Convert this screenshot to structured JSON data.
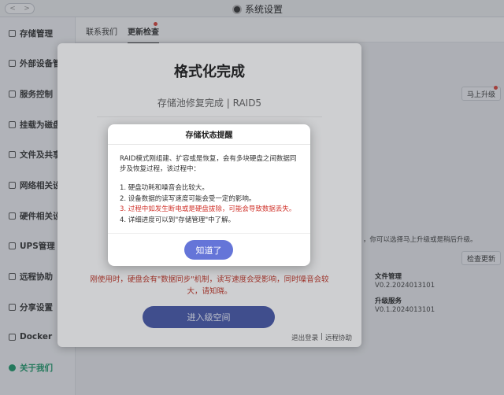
{
  "window": {
    "title": "系统设置",
    "nav_back": "<",
    "nav_forward": ">"
  },
  "sidebar": {
    "items": [
      {
        "label": "存储管理",
        "icon": "storage-icon"
      },
      {
        "label": "外部设备管理",
        "icon": "device-icon"
      },
      {
        "label": "服务控制",
        "icon": "toggle-icon"
      },
      {
        "label": "挂载为磁盘",
        "icon": "disk-icon"
      },
      {
        "label": "文件及共享协议",
        "icon": "folder-icon"
      },
      {
        "label": "网络相关设置",
        "icon": "network-icon"
      },
      {
        "label": "硬件相关设置",
        "icon": "hardware-icon"
      },
      {
        "label": "UPS管理",
        "icon": "ups-icon"
      },
      {
        "label": "远程协助",
        "icon": "remote-icon"
      },
      {
        "label": "分享设置",
        "icon": "share-icon"
      },
      {
        "label": "Docker",
        "icon": "docker-icon"
      },
      {
        "label": "关于我们",
        "icon": "info-icon"
      }
    ],
    "active_index": 11,
    "accent_color": "#1a9c6a"
  },
  "tabs": [
    {
      "label": "联系我们"
    },
    {
      "label": "更新检查"
    }
  ],
  "background": {
    "upgrade_now_label": "马上升级",
    "upgrade_note": "，你可以选择马上升级或是稍后升级。",
    "check_update_label": "检查更新",
    "file_manager": {
      "title": "文件管理",
      "version": "V0.2.2024013101"
    },
    "upgrade_service": {
      "title": "升级服务",
      "version": "V0.1.2024013101"
    }
  },
  "panel": {
    "title": "格式化完成",
    "subtitle": "存储池修复完成 | RAID5",
    "warning": "刚使用时，硬盘会有\"数据同步\"机制，读写速度会受影响，同时噪音会较大，请知晓。",
    "enter_button": "进入级空间",
    "links": [
      "退出登录",
      "|",
      "远程协助"
    ]
  },
  "dialog": {
    "title": "存储状态提醒",
    "intro": "RAID模式刚组建、扩容或是恢复，会有多块硬盘之间数据同步及恢复过程，该过程中：",
    "items": [
      {
        "text": "1. 硬盘功耗和噪音会比较大。",
        "warn": false
      },
      {
        "text": "2. 设备数据的读写速度可能会受一定的影响。",
        "warn": false
      },
      {
        "text": "3. 过程中如发生断电或是硬盘拔除，可能会导致数据丢失。",
        "warn": true
      },
      {
        "text": "4. 详细进度可以到\"存储管理\"中了解。",
        "warn": false
      }
    ],
    "ok_button": "知道了",
    "warn_color": "#d0342c",
    "button_color": "#6575d8"
  }
}
